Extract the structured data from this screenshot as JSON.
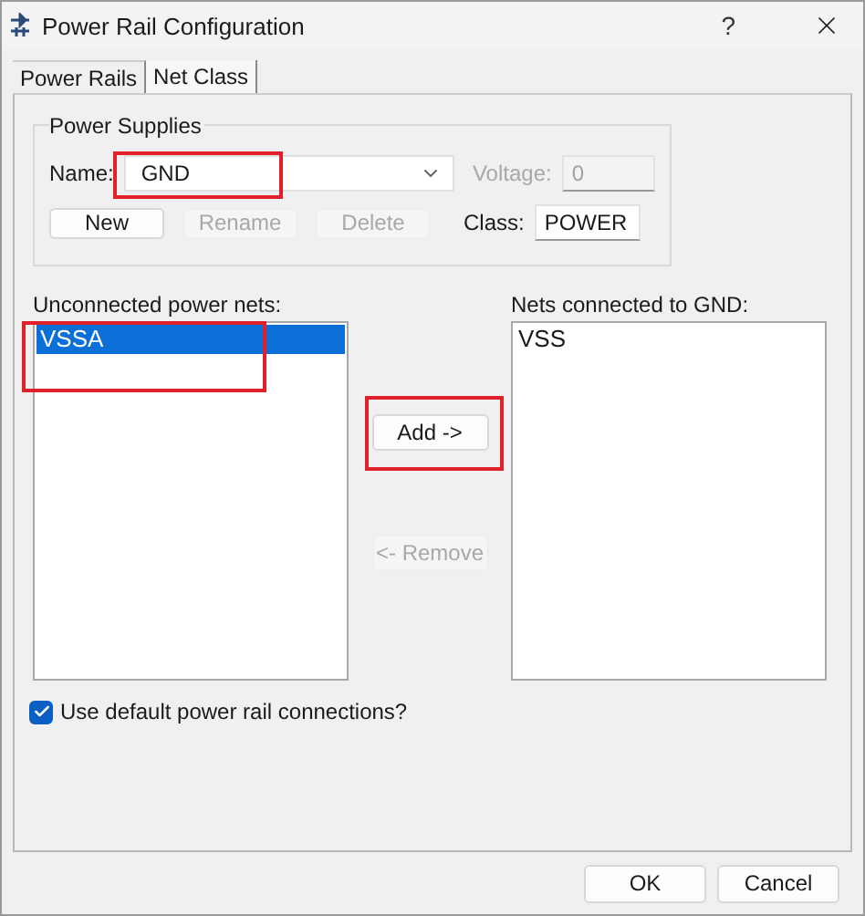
{
  "window": {
    "title": "Power Rail Configuration",
    "help": "?"
  },
  "tabs": [
    {
      "label": "Power Rails",
      "selected": true
    },
    {
      "label": "Net Class",
      "selected": false
    }
  ],
  "power_supplies": {
    "title": "Power Supplies",
    "name_label": "Name:",
    "name_value": "GND",
    "voltage_label": "Voltage:",
    "voltage_value": "0",
    "voltage_disabled": true,
    "buttons": [
      {
        "label": "New",
        "disabled": false
      },
      {
        "label": "Rename",
        "disabled": true
      },
      {
        "label": "Delete",
        "disabled": true
      }
    ],
    "class_label": "Class:",
    "class_value": "POWER"
  },
  "unconnected": {
    "label": "Unconnected power nets:",
    "items": [
      {
        "label": "VSSA",
        "selected": true
      }
    ]
  },
  "transfer_buttons": [
    {
      "label": "Add ->",
      "disabled": false
    },
    {
      "label": "<- Remove",
      "disabled": true
    }
  ],
  "connected": {
    "label": "Nets connected to GND:",
    "items": [
      {
        "label": "VSS",
        "selected": false
      }
    ]
  },
  "use_default": {
    "label": "Use default power rail connections?",
    "checked": true
  },
  "footer_buttons": [
    {
      "label": "OK"
    },
    {
      "label": "Cancel"
    }
  ]
}
